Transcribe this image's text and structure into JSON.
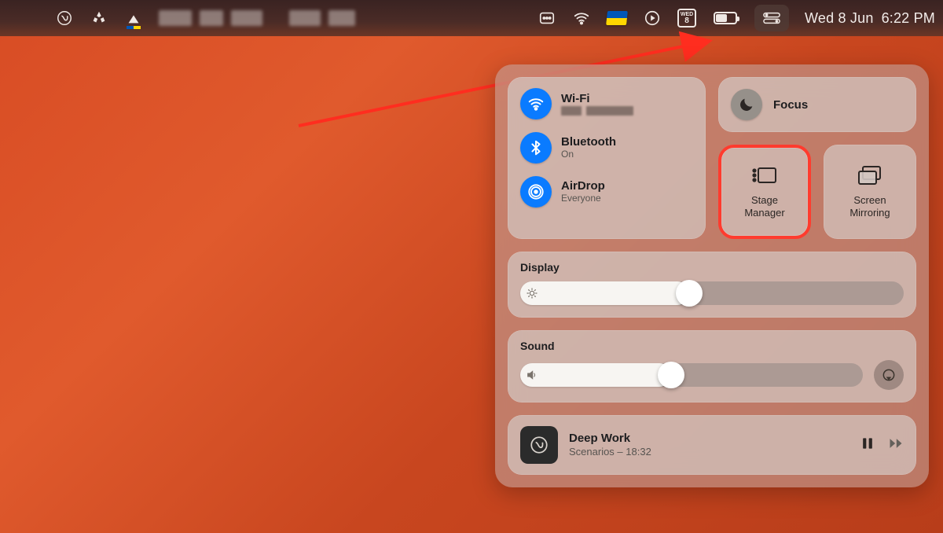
{
  "menubar": {
    "date": "Wed 8 Jun",
    "time": "6:22 PM",
    "calendar": {
      "dow": "WED",
      "day": "8"
    }
  },
  "controlCenter": {
    "wifi": {
      "title": "Wi-Fi"
    },
    "bluetooth": {
      "title": "Bluetooth",
      "status": "On"
    },
    "airdrop": {
      "title": "AirDrop",
      "status": "Everyone"
    },
    "focus": {
      "title": "Focus"
    },
    "stageManager": {
      "line1": "Stage",
      "line2": "Manager"
    },
    "screenMirroring": {
      "line1": "Screen",
      "line2": "Mirroring"
    },
    "display": {
      "title": "Display",
      "level_percent": 44
    },
    "sound": {
      "title": "Sound",
      "level_percent": 44
    },
    "nowPlaying": {
      "title": "Deep Work",
      "subtitle": "Scenarios – 18:32"
    }
  },
  "annotation": {
    "highlight": "stage-manager",
    "arrow_color": "#ff2d1f"
  },
  "colors": {
    "accent_blue": "#0a7bff",
    "highlight_red": "#ff3b2e"
  }
}
